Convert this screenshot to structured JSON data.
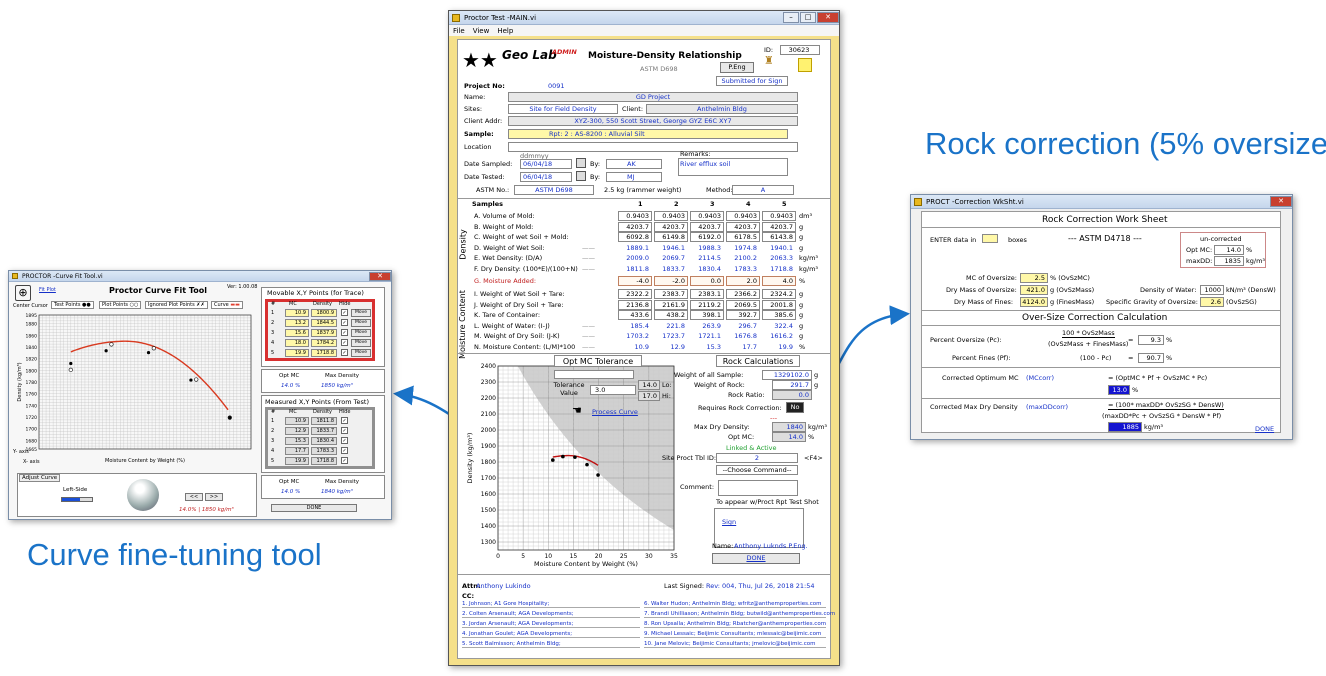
{
  "callouts": {
    "rock": "Rock correction (5% oversize)",
    "curve": "Curve fine-tuning tool"
  },
  "main": {
    "title": "Proctor Test -MAIN.vi",
    "menu": [
      "File",
      "View",
      "Help"
    ],
    "logo_text": "Geo Lab",
    "admin": "ADMIN",
    "heading": "Moisture-Density Relationship",
    "standard": "ASTM D698",
    "id_label": "ID:",
    "id_value": "30623",
    "p_eng": "P.Eng",
    "submitted": "Submitted for Sign",
    "project_label": "Project No:",
    "project_value": "0091",
    "name_label": "Name:",
    "name_value": "GD Project",
    "sites_label": "Sites:",
    "sites_value": "Site for Field Density",
    "client_label": "Client:",
    "client_value": "Anthelmin Bldg",
    "addr_label": "Client Addr:",
    "addr_value": "XYZ-300, 550 Scott Street, George GYZ E6C XY7",
    "sample_label": "Sample:",
    "sample_value": "Rpt: 2     : AS-8200     : Alluvial Silt",
    "location_label": "Location",
    "ddmmyy": "ddmmyy",
    "sampled_label": "Date Sampled:",
    "sampled_value": "06/04/18",
    "tested_label": "Date Tested:",
    "tested_value": "06/04/18",
    "by_label": "By:",
    "by1": "AK",
    "by2": "MJ",
    "remarks_label": "Remarks:",
    "remarks_value": "River efflux soil",
    "astm_label": "ASTM No.:",
    "astm_value": "ASTM D698",
    "rammer": "2.5 kg (rammer weight)",
    "method_label": "Method:",
    "method_value": "A",
    "samples_label": "Samples",
    "sample_nums": [
      "1",
      "2",
      "3",
      "4",
      "5"
    ],
    "density_side": "Density",
    "moisture_side": "Moisture Content",
    "rows": [
      {
        "label": "A. Volume of Mold:",
        "v": [
          "0.9403",
          "0.9403",
          "0.9403",
          "0.9403",
          "0.9403"
        ],
        "unit": "dm³",
        "style": "box"
      },
      {
        "label": "B. Weight of Mold:",
        "v": [
          "4203.7",
          "4203.7",
          "4203.7",
          "4203.7",
          "4203.7"
        ],
        "unit": "g",
        "style": "box"
      },
      {
        "label": "C. Weight of wet Soil + Mold:",
        "v": [
          "6092.8",
          "6149.8",
          "6192.0",
          "6178.5",
          "6143.8"
        ],
        "unit": "g",
        "style": "box"
      },
      {
        "label": "D. Weight of Wet Soil:",
        "v": [
          "1889.1",
          "1946.1",
          "1988.3",
          "1974.8",
          "1940.1"
        ],
        "unit": "g",
        "style": "blue"
      },
      {
        "label": "E. Wet Density: (D/A)",
        "v": [
          "2009.0",
          "2069.7",
          "2114.5",
          "2100.2",
          "2063.3"
        ],
        "unit": "kg/m³",
        "style": "blue"
      },
      {
        "label": "F. Dry Density: (100*E)/(100+N)",
        "v": [
          "1811.8",
          "1833.7",
          "1830.4",
          "1783.3",
          "1718.8"
        ],
        "unit": "kg/m³",
        "style": "blue"
      },
      {
        "label": "G. Moisture Added:",
        "v": [
          "-4.0",
          "-2.0",
          "0.0",
          "2.0",
          "4.0"
        ],
        "unit": "%",
        "style": "red"
      },
      {
        "label": "I. Weight of Wet Soil + Tare:",
        "v": [
          "2322.2",
          "2383.7",
          "2383.1",
          "2366.2",
          "2324.2"
        ],
        "unit": "g",
        "style": "box"
      },
      {
        "label": "J. Weight of Dry Soil + Tare:",
        "v": [
          "2136.8",
          "2161.9",
          "2119.2",
          "2069.5",
          "2001.8"
        ],
        "unit": "g",
        "style": "box"
      },
      {
        "label": "K. Tare of Container:",
        "v": [
          "433.6",
          "438.2",
          "398.1",
          "392.7",
          "385.6"
        ],
        "unit": "g",
        "style": "box"
      },
      {
        "label": "L. Weight of Water: (I-J)",
        "v": [
          "185.4",
          "221.8",
          "263.9",
          "296.7",
          "322.4"
        ],
        "unit": "g",
        "style": "blue"
      },
      {
        "label": "M. Weight of Dry Soil: (J-K)",
        "v": [
          "1703.2",
          "1723.7",
          "1721.1",
          "1676.8",
          "1616.2"
        ],
        "unit": "g",
        "style": "blue"
      },
      {
        "label": "N. Moisture Content: (L/M)*100",
        "v": [
          "10.9",
          "12.9",
          "15.3",
          "17.7",
          "19.9"
        ],
        "unit": "%",
        "style": "blue"
      }
    ],
    "opt_title": "Opt MC Tolerance",
    "tolerance_label": "Tolerance Value",
    "tolerance_value": "3.0",
    "lo_value": "14.0",
    "lo_label": "Lo:",
    "hi_value": "17.0",
    "hi_label": "Hi:",
    "process_curve": "Process Curve",
    "rock_title": "Rock Calculations",
    "wt_all_label": "Weight of all Sample:",
    "wt_all_value": "1329102.0",
    "wt_rock_label": "Weight of Rock:",
    "wt_rock_value": "291.7",
    "rock_ratio_label": "Rock Ratio:",
    "rock_ratio_value": "0.0",
    "req_label": "Requires Rock Correction:",
    "req_value": "No",
    "dashes": "---",
    "maxdd_label": "Max Dry Density:",
    "maxdd_value": "1840",
    "maxdd_unit": "kg/m³",
    "optmc_label": "Opt MC:",
    "optmc_value": "14.0",
    "optmc_unit": "%",
    "linked": "Linked & Active",
    "site_tbl_label": "Site Proct Tbl ID:",
    "site_tbl_value": "2",
    "f4": "<F4>",
    "choose": "--Choose Command--",
    "comment_label": "Comment:",
    "appear": "To appear w/Proct Rpt Test Shot",
    "sign": "Sign",
    "name2_label": "Name:",
    "name2_value": "Anthony Luknds     P.Eng.",
    "done": "DONE",
    "chart_ylabel": "Density (kg/m³)",
    "chart_xlabel": "Moisture Content by Weight (%)",
    "yticks": [
      "2400",
      "2300",
      "2200",
      "2100",
      "2000",
      "1900",
      "1800",
      "1700",
      "1600",
      "1500",
      "1400",
      "1300"
    ],
    "xticks": [
      "0",
      "5",
      "10",
      "15",
      "20",
      "25",
      "30",
      "35"
    ],
    "attn_label": "Attn:",
    "attn_value": "Anthony Lukindo",
    "last_signed_label": "Last Signed:",
    "last_signed_value": "Rev: 004, Thu, Jul 26, 2018 21:54",
    "cc_label": "CC:",
    "cc_left": [
      "1. Johnson; A1 Gore Hospitality;",
      "2. Colten Arsenault; AGA Developments;",
      "3. Jordan Arsenault; AGA Developments;",
      "4. Jonathan Goulet; AGA Developments;",
      "5. Scott Balmisson; Anthelmin Bldg;"
    ],
    "cc_right": [
      "6. Walter Hudon; Anthelmin Bldg; wfritz@anthemproperties.com",
      "7. Brandi Uhilliason; Anthelmin Bldg; butwild@anthemproperties.com",
      "8. Ron Upsalla; Anthelmin Bldg; Rbatcher@anthemproperties.com",
      "9. Michael Lessaic; Beijimic Consultants; mlessaic@beijimic.com",
      "10. Jane Melovic; Beijimic Consultants; jmelovic@beijimic.com"
    ]
  },
  "rock": {
    "title": "PROCT -Correction WkSht.vi",
    "heading": "Rock Correction Work Sheet",
    "enter": "ENTER data in",
    "boxes": "boxes",
    "astm": "--- ASTM D4718 ---",
    "uncorrected": "un-corrected",
    "optmc_label": "Opt MC:",
    "optmc_value": "14.0",
    "optmc_unit": "%",
    "maxdd_label": "maxDD:",
    "maxdd_value": "1835",
    "maxdd_unit": "kg/m³",
    "mc_over_label": "MC of Oversize:",
    "mc_over_value": "2.5",
    "mc_over_unit": "% (OvSzMC)",
    "dry_over_label": "Dry Mass of Oversize:",
    "dry_over_value": "421.0",
    "dry_over_unit": "g  (OvSzMass)",
    "dry_fines_label": "Dry Mass of Fines:",
    "dry_fines_value": "4124.0",
    "dry_fines_unit": "g  (FinesMass)",
    "water_label": "Density of Water:",
    "water_value": "1000",
    "water_unit": "kN/m³ (DensW)",
    "sg_label": "Specific Gravity of Oversize:",
    "sg_value": "2.6",
    "sg_unit": "(OvSzSG)",
    "calc_heading": "Over-Size Correction Calculation",
    "pc_label": "Percent Oversize (Pc):",
    "pc_num": "100 * OvSzMass",
    "pc_den": "(OvSzMass + FinesMass)",
    "pc_value": "9.3",
    "pc_unit": "%",
    "pf_label": "Percent Fines (Pf):",
    "pf_formula": "(100 - Pc)",
    "pf_value": "90.7",
    "pf_unit": "%",
    "mc_corr_label": "Corrected  Optimum MC",
    "mc_corr_var": "(MCcorr)",
    "mc_corr_formula": "= (OptMC * Pf + OvSzMC * Pc)",
    "mc_corr_value": "13.0",
    "mc_corr_unit": "%",
    "dd_corr_label": "Corrected Max Dry Density",
    "dd_corr_var": "(maxDDcorr)",
    "dd_corr_num": "= (100* maxDD* OvSzSG * DensW)",
    "dd_corr_den": "(maxDD*Pc + OvSzSG * DensW * Pf)",
    "dd_corr_value": "1885",
    "dd_corr_unit": "kg/m³",
    "done": "DONE"
  },
  "curve": {
    "title": "PROCTOR -Curve Fit Tool.vi",
    "fit_plot": "Fit Plot",
    "heading": "Proctor Curve Fit Tool",
    "ver": "Ver: 1.00.08",
    "center_cursor": "Center Cursor",
    "test_points": "Test Points",
    "plot_points": "Plot Points",
    "ignored": "Ignored Plot Points",
    "curve_label": "Curve",
    "y_axis": "Y- axis",
    "x_axis": "X- axis",
    "ylabel": "Density (kg/m³)",
    "xlabel": "Moisture Content by Weight (%)",
    "yticks": [
      "1895",
      "1880",
      "1860",
      "1840",
      "1820",
      "1800",
      "1780",
      "1760",
      "1740",
      "1720",
      "1700",
      "1680",
      "1665"
    ],
    "movable_title": "Movable X,Y Points (for Trace)",
    "measured_title": "Measured X,Y Points (From Test)",
    "cols": [
      "#",
      "MC",
      "Density",
      "Hide"
    ],
    "movable": [
      [
        "1",
        "10.9",
        "1800.9"
      ],
      [
        "2",
        "13.2",
        "1844.5"
      ],
      [
        "3",
        "15.6",
        "1837.9"
      ],
      [
        "4",
        "18.0",
        "1784.2"
      ],
      [
        "5",
        "19.9",
        "1718.8"
      ]
    ],
    "measured": [
      [
        "1",
        "10.9",
        "1811.8"
      ],
      [
        "2",
        "12.9",
        "1833.7"
      ],
      [
        "3",
        "15.3",
        "1830.4"
      ],
      [
        "4",
        "17.7",
        "1783.3"
      ],
      [
        "5",
        "19.9",
        "1718.8"
      ]
    ],
    "move": "Move",
    "opt_mc_label": "Opt MC",
    "max_den_label": "Max Density",
    "opt_mc_1": "14.0 %",
    "max_den_1": "1850 kg/m³",
    "opt_mc_2": "14.0 %",
    "max_den_2": "1840 kg/m³",
    "adjust": "Adjust Curve",
    "left_side": "Left-Side",
    "bottom_vals": "14.0%  |  1850 kg/m³",
    "done": "DONE"
  },
  "chart_data": {
    "type": "scatter",
    "x": [
      10.9,
      12.9,
      15.3,
      17.7,
      19.9
    ],
    "y": [
      1811.8,
      1833.7,
      1830.4,
      1783.3,
      1718.8
    ],
    "xlabel": "Moisture Content by Weight (%)",
    "ylabel": "Density (kg/m³)",
    "xlim": [
      0,
      35
    ],
    "ylim": [
      1250,
      2400
    ],
    "grid": true
  }
}
